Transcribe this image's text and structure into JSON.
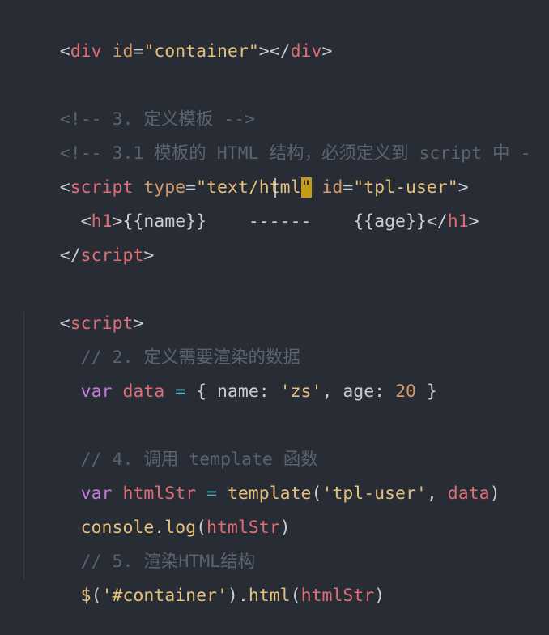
{
  "colors": {
    "background": "#282c34",
    "punct": "#c8ccd4",
    "tag": "#e06c75",
    "attr": "#d19a66",
    "string": "#e5c07b",
    "comment": "#5c6370",
    "keyword": "#c678dd",
    "variable": "#e06c75",
    "function": "#61afef",
    "number": "#d19a66",
    "plain": "#abb2bf",
    "cursor": "#c49a1b"
  },
  "code": {
    "line1": {
      "lt": "<",
      "tag": "div",
      "attr": " id",
      "eq": "=",
      "val": "\"container\"",
      "gt": ">",
      "close": "</",
      "tag2": "div",
      "gt2": ">"
    },
    "line3": {
      "text": "<!-- 3. 定义模板 -->"
    },
    "line4": {
      "text": "<!-- 3.1 模板的 HTML 结构，必须定义到 script 中 -"
    },
    "line5": {
      "lt": "<",
      "tag": "script",
      "attr1": " type",
      "eq1": "=",
      "val1a": "\"text/h",
      "val1b": "t",
      "val1c": "ml",
      "val1d": "\"",
      "attr2": " id",
      "eq2": "=",
      "val2": "\"tpl-user\"",
      "gt": ">"
    },
    "line6": {
      "indent": "  ",
      "lt": "<",
      "tag": "h1",
      "gt": ">",
      "content": "{{name}}    ------    {{age}}",
      "close": "</",
      "tag2": "h1",
      "gt2": ">"
    },
    "line7": {
      "close": "</",
      "tag": "script",
      "gt": ">"
    },
    "line9": {
      "lt": "<",
      "tag": "script",
      "gt": ">"
    },
    "line10": {
      "text": "  // 2. 定义需要渲染的数据"
    },
    "line11": {
      "indent": "  ",
      "kw": "var",
      "name": " data",
      "op": " = ",
      "brace": "{ ",
      "k1": "name",
      "c1": ": ",
      "v1": "'zs'",
      "comma": ", ",
      "k2": "age",
      "c2": ": ",
      "v2": "20",
      "brace2": " }"
    },
    "line13": {
      "text": "  // 4. 调用 template 函数"
    },
    "line14": {
      "indent": "  ",
      "kw": "var",
      "name": " htmlStr",
      "op": " = ",
      "fn": "template",
      "p1": "(",
      "arg1": "'tpl-user'",
      "comma": ", ",
      "arg2": "data",
      "p2": ")"
    },
    "line15": {
      "indent": "  ",
      "obj": "console",
      "dot": ".",
      "fn": "log",
      "p1": "(",
      "arg": "htmlStr",
      "p2": ")"
    },
    "line16": {
      "text": "  // 5. 渲染HTML结构"
    },
    "line17": {
      "indent": "  ",
      "fn": "$",
      "p1": "(",
      "arg": "'#container'",
      "p2": ")",
      "dot": ".",
      "fn2": "html",
      "p3": "(",
      "arg2": "htmlStr",
      "p4": ")"
    }
  }
}
